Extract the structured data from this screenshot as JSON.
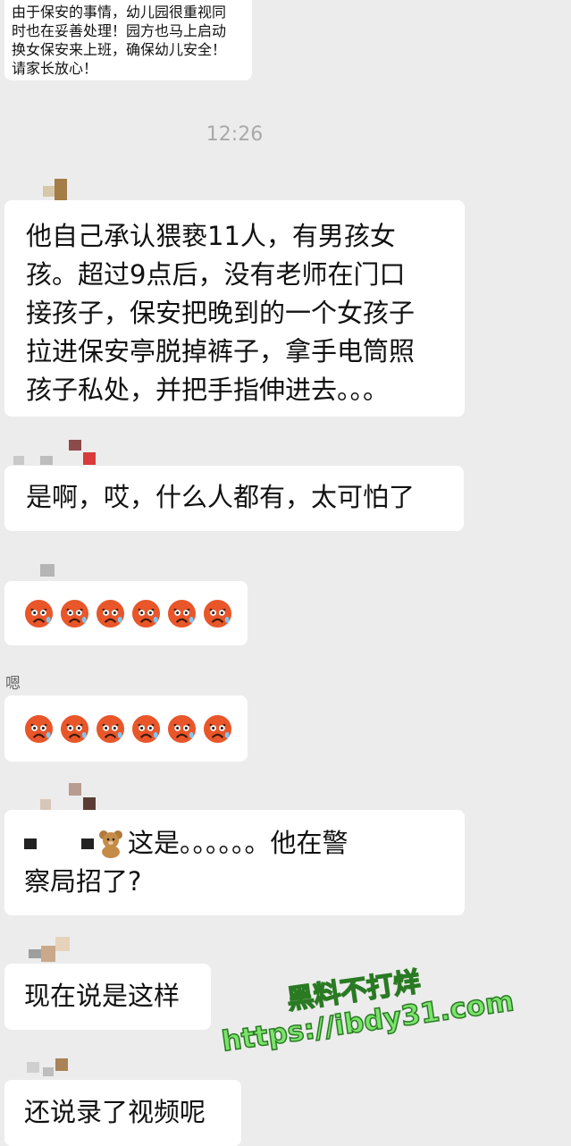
{
  "messages": {
    "top_notice": "由于保安的事情，幼儿园很重视同\n时也在妥善处理！园方也马上启动\n换女保安来上班，确保幼儿安全！\n请家长放心！",
    "timestamp": "12:26",
    "msg1": "他自己承认猥亵11人，有男孩女\n孩。超过9点后，没有老师在门口\n接孩子，保安把晚到的一个女孩子\n拉进保安亭脱掉裤子，拿手电筒照\n孩子私处，并把手指伸进去。。。",
    "msg2": "是啊，哎，什么人都有，太可怕了",
    "sender_hint": "嗯",
    "msg5_line1": "这是。。。。。。他在警",
    "msg5_line2": "察局招了?",
    "msg6": "现在说是这样",
    "msg7": "还说录了视频呢"
  },
  "emoji_rows": {
    "row1_count": 6,
    "row2_count": 6
  },
  "watermark": {
    "line1": "黑料不打烊",
    "line2": "https://ibdy31.com"
  },
  "colors": {
    "background": "#ececec",
    "bubble": "#ffffff",
    "watermark": "#7be36c"
  }
}
